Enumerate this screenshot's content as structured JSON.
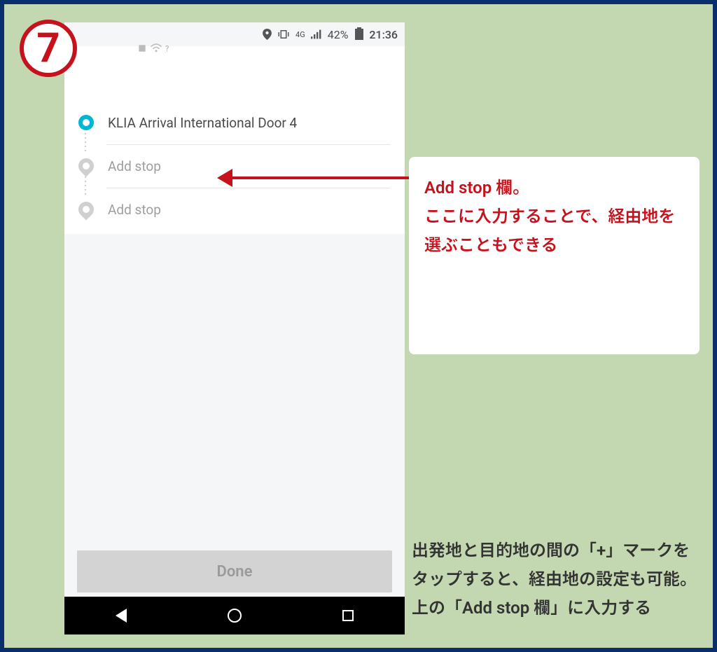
{
  "step_number": "7",
  "status_bar": {
    "wifi_help": "?",
    "network": "4G",
    "battery_pct": "42%",
    "time": "21:36"
  },
  "stops": {
    "origin_label": "KLIA Arrival International Door 4",
    "add_stop_1": "Add stop",
    "add_stop_2": "Add stop"
  },
  "done_button": "Done",
  "callout": {
    "line1": "Add stop 欄。",
    "line2": "ここに入力することで、経由地を選ぶこともできる"
  },
  "bottom_note": "出発地と目的地の間の「+」マークをタップすると、経由地の設定も可能。上の「Add stop 欄」に入力する"
}
